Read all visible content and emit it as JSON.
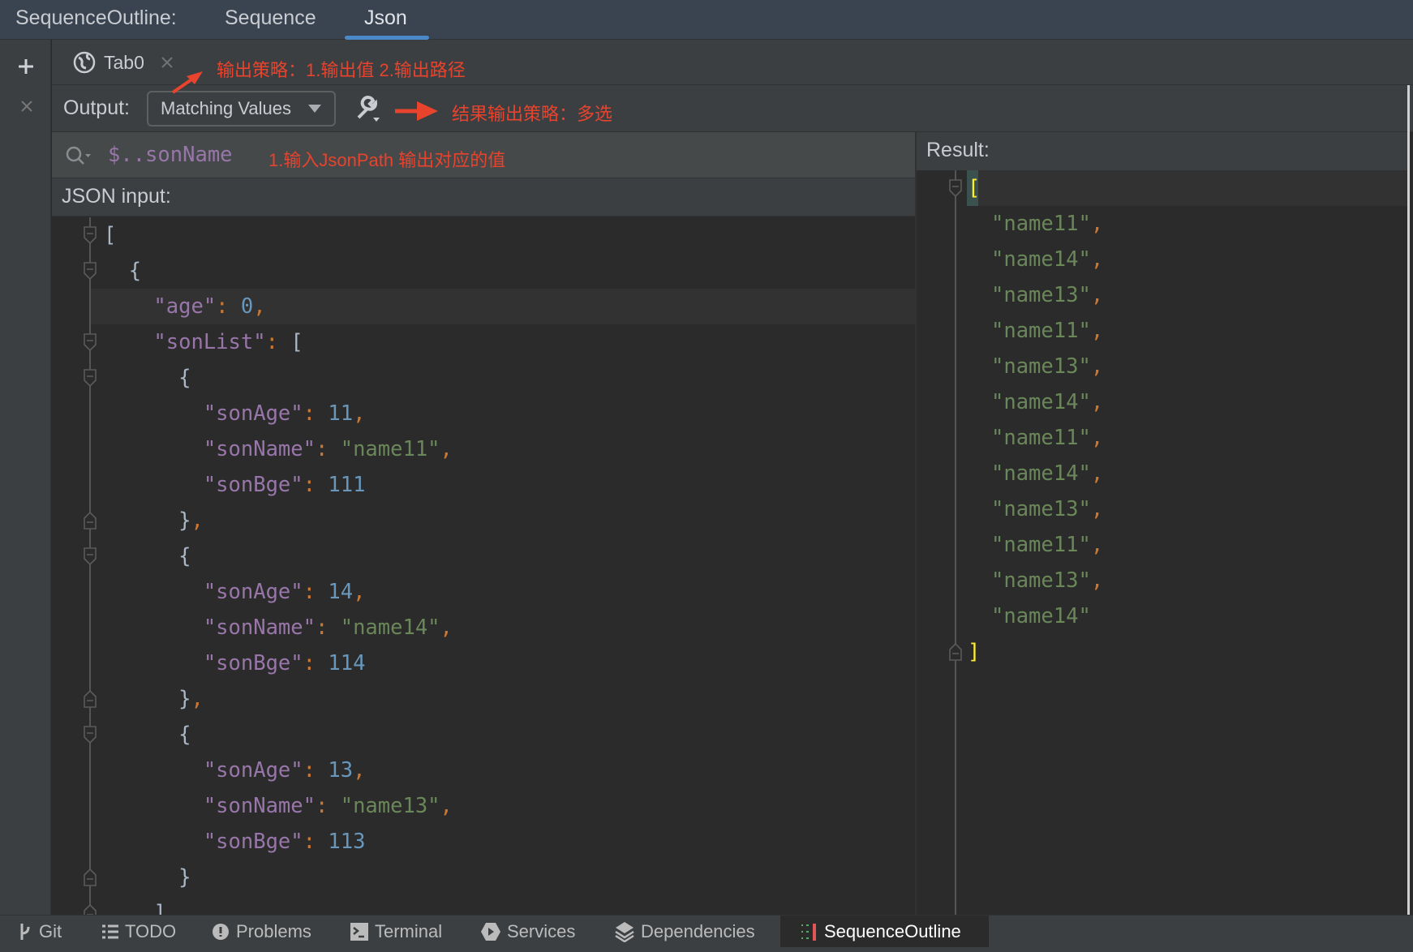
{
  "top_tabs": {
    "title": "SequenceOutline:",
    "tabs": [
      {
        "label": "Sequence",
        "active": false
      },
      {
        "label": "Json",
        "active": true
      }
    ]
  },
  "left_strip": {
    "add_icon": "plus-icon",
    "close_icon": "close-icon"
  },
  "editor_tabs": [
    {
      "label": "Tab0",
      "icon": "globe-icon"
    }
  ],
  "output": {
    "label": "Output:",
    "selected": "Matching Values",
    "settings_icon": "wrench-icon"
  },
  "search": {
    "query": "$..sonName",
    "icon": "search-icon"
  },
  "json_input": {
    "label": "JSON input:",
    "lines": [
      [
        {
          "t": "[",
          "c": "b"
        }
      ],
      [
        {
          "t": "  {",
          "c": "b"
        }
      ],
      [
        {
          "t": "    \"age\"",
          "c": "k"
        },
        {
          "t": ": ",
          "c": "p"
        },
        {
          "t": "0",
          "c": "n"
        },
        {
          "t": ",",
          "c": "p"
        }
      ],
      [
        {
          "t": "    \"sonList\"",
          "c": "k"
        },
        {
          "t": ": ",
          "c": "p"
        },
        {
          "t": "[",
          "c": "b"
        }
      ],
      [
        {
          "t": "      {",
          "c": "b"
        }
      ],
      [
        {
          "t": "        \"sonAge\"",
          "c": "k"
        },
        {
          "t": ": ",
          "c": "p"
        },
        {
          "t": "11",
          "c": "n"
        },
        {
          "t": ",",
          "c": "p"
        }
      ],
      [
        {
          "t": "        \"sonName\"",
          "c": "k"
        },
        {
          "t": ": ",
          "c": "p"
        },
        {
          "t": "\"name11\"",
          "c": "s"
        },
        {
          "t": ",",
          "c": "p"
        }
      ],
      [
        {
          "t": "        \"sonBge\"",
          "c": "k"
        },
        {
          "t": ": ",
          "c": "p"
        },
        {
          "t": "111",
          "c": "n"
        }
      ],
      [
        {
          "t": "      }",
          "c": "b"
        },
        {
          "t": ",",
          "c": "p"
        }
      ],
      [
        {
          "t": "      {",
          "c": "b"
        }
      ],
      [
        {
          "t": "        \"sonAge\"",
          "c": "k"
        },
        {
          "t": ": ",
          "c": "p"
        },
        {
          "t": "14",
          "c": "n"
        },
        {
          "t": ",",
          "c": "p"
        }
      ],
      [
        {
          "t": "        \"sonName\"",
          "c": "k"
        },
        {
          "t": ": ",
          "c": "p"
        },
        {
          "t": "\"name14\"",
          "c": "s"
        },
        {
          "t": ",",
          "c": "p"
        }
      ],
      [
        {
          "t": "        \"sonBge\"",
          "c": "k"
        },
        {
          "t": ": ",
          "c": "p"
        },
        {
          "t": "114",
          "c": "n"
        }
      ],
      [
        {
          "t": "      }",
          "c": "b"
        },
        {
          "t": ",",
          "c": "p"
        }
      ],
      [
        {
          "t": "      {",
          "c": "b"
        }
      ],
      [
        {
          "t": "        \"sonAge\"",
          "c": "k"
        },
        {
          "t": ": ",
          "c": "p"
        },
        {
          "t": "13",
          "c": "n"
        },
        {
          "t": ",",
          "c": "p"
        }
      ],
      [
        {
          "t": "        \"sonName\"",
          "c": "k"
        },
        {
          "t": ": ",
          "c": "p"
        },
        {
          "t": "\"name13\"",
          "c": "s"
        },
        {
          "t": ",",
          "c": "p"
        }
      ],
      [
        {
          "t": "        \"sonBge\"",
          "c": "k"
        },
        {
          "t": ": ",
          "c": "p"
        },
        {
          "t": "113",
          "c": "n"
        }
      ],
      [
        {
          "t": "      }",
          "c": "b"
        }
      ],
      [
        {
          "t": "    ]",
          "c": "b"
        }
      ]
    ]
  },
  "result": {
    "label": "Result:",
    "open": "[",
    "values": [
      "\"name11\"",
      "\"name14\"",
      "\"name13\"",
      "\"name11\"",
      "\"name13\"",
      "\"name14\"",
      "\"name11\"",
      "\"name14\"",
      "\"name13\"",
      "\"name11\"",
      "\"name13\"",
      "\"name14\""
    ],
    "close": "]"
  },
  "annotations": {
    "output_strategy": "输出策略：1.输出值 2.输出路径",
    "result_strategy": "结果输出策略：多选",
    "jsonpath_hint": "1.输入JsonPath 输出对应的值",
    "color": "#e8432d"
  },
  "bottom_bar": [
    {
      "label": "Git",
      "icon": "git-branch-icon"
    },
    {
      "label": "TODO",
      "icon": "list-icon"
    },
    {
      "label": "Problems",
      "icon": "warning-icon"
    },
    {
      "label": "Terminal",
      "icon": "terminal-icon"
    },
    {
      "label": "Services",
      "icon": "services-icon"
    },
    {
      "label": "Dependencies",
      "icon": "layers-icon"
    },
    {
      "label": "SequenceOutline",
      "icon": "sequence-icon",
      "active": true
    }
  ],
  "colors": {
    "key": "#9876aa",
    "number": "#6897bb",
    "string": "#6a8759",
    "punct": "#cc7832",
    "accent": "#4a88c7",
    "bracket_match": "#ffef28"
  }
}
